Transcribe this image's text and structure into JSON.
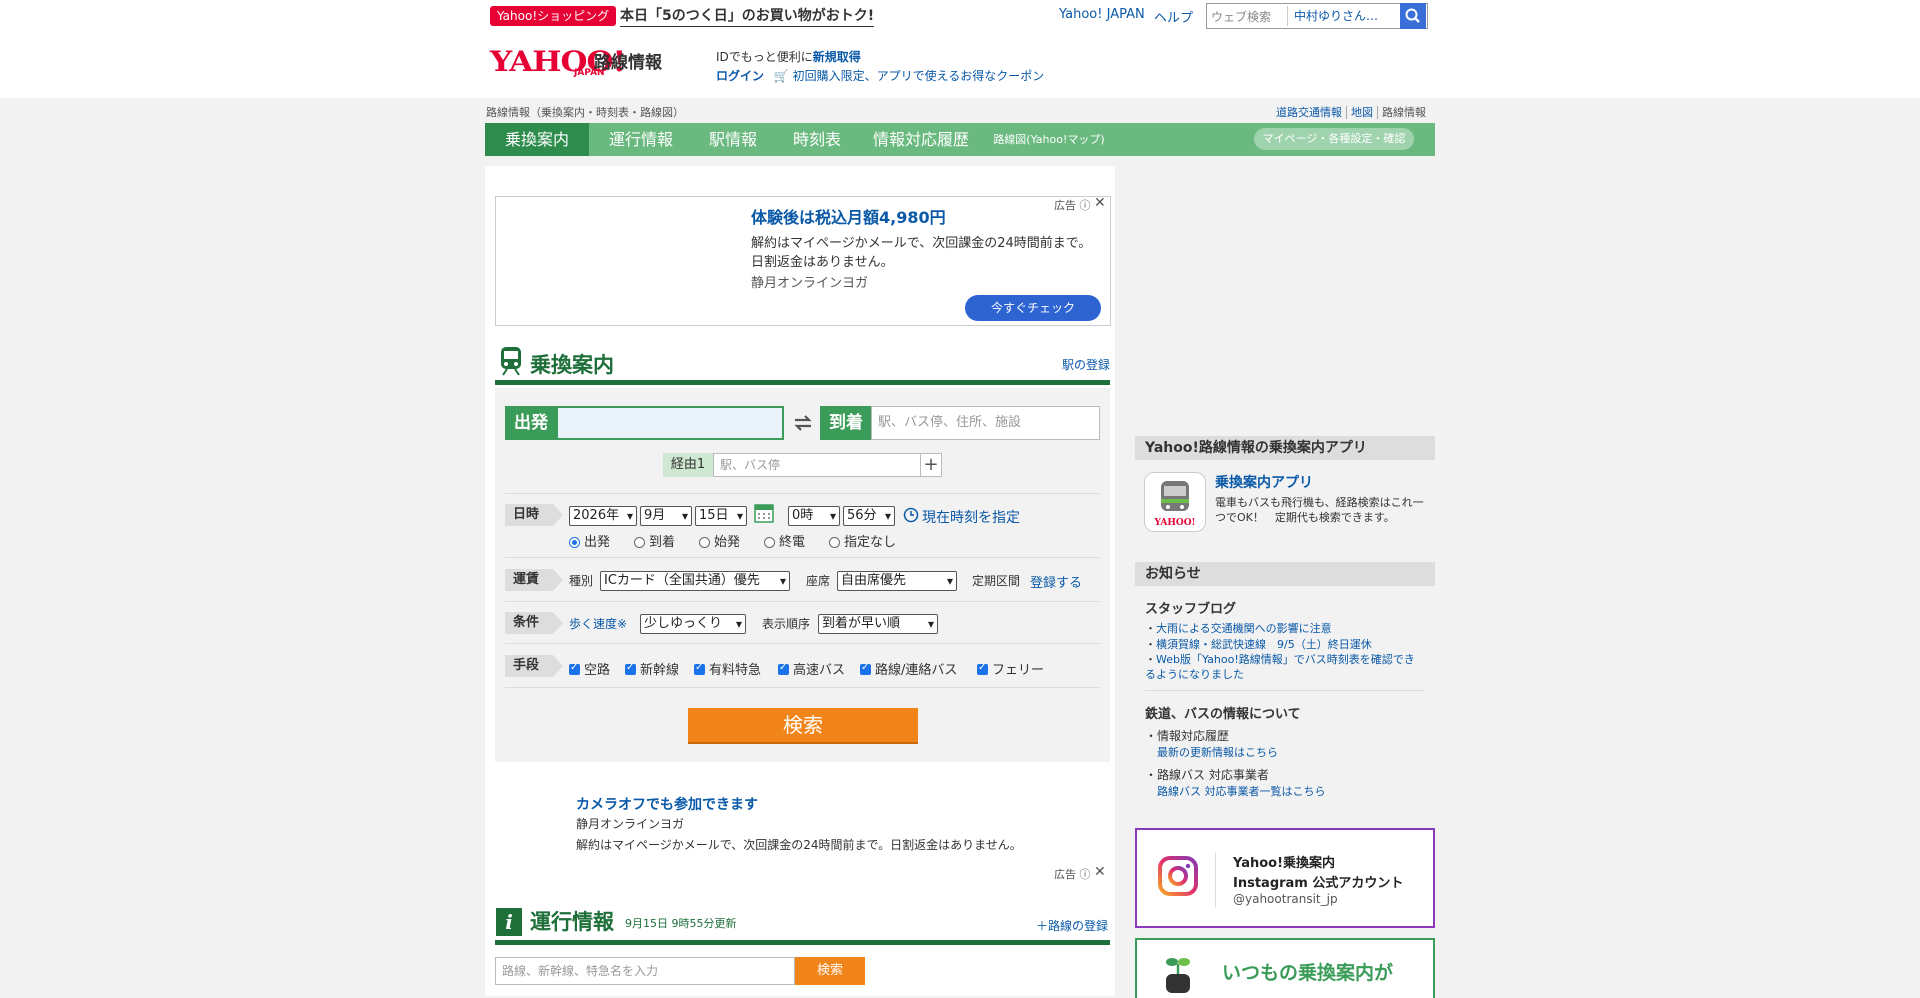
{
  "header": {
    "promo_tag": "Yahoo!ショッピング",
    "promo_text": "本日「5のつく日」のお買い物がおトク!",
    "link_japan": "Yahoo! JAPAN",
    "link_help": "ヘルプ",
    "search_placeholder": "ウェブ検索",
    "search_query": "中村ゆりさん…",
    "logo_text": "YAHOO!",
    "logo_sub": "JAPAN",
    "site_title": "路線情報",
    "id_line1_prefix": "IDでもっと便利に",
    "id_line1_link": "新規取得",
    "login": "ログイン",
    "coupon": "初回購入限定、アプリで使えるお得なクーポン"
  },
  "subbar": {
    "breadcrumb": "路線情報（乗換案内・時刻表・路線図）",
    "links": [
      "道路交通情報",
      "地図",
      "路線情報"
    ]
  },
  "nav": {
    "items": [
      "乗換案内",
      "運行情報",
      "駅情報",
      "時刻表",
      "情報対応履歴",
      "路線図(Yahoo!マップ)"
    ],
    "mypage": "マイページ・各種設定・確認"
  },
  "ad1": {
    "headline": "体験後は税込月額4,980円",
    "line1": "解約はマイページかメールで、次回課金の24時間前まで。",
    "line2": "日割返金はありません。",
    "sponsor": "静月オンラインヨガ",
    "button": "今すぐチェック",
    "label": "広告"
  },
  "transfer": {
    "title": "乗換案内",
    "register_station": "駅の登録",
    "from_label": "出発",
    "to_label": "到着",
    "to_placeholder": "駅、バス停、住所、施設",
    "via_label": "経由1",
    "via_placeholder": "駅、バス停",
    "date_label": "日時",
    "year": "2026年",
    "month": "9月",
    "day": "15日",
    "hour": "0時",
    "minute": "56分",
    "now_link": "現在時刻を指定",
    "time_options": [
      "出発",
      "到着",
      "始発",
      "終電",
      "指定なし"
    ],
    "fare_label": "運賃",
    "fare_type_label": "種別",
    "fare_type": "ICカード（全国共通）優先",
    "seat_label": "座席",
    "seat": "自由席優先",
    "commuter_label": "定期区間",
    "commuter_link": "登録する",
    "cond_label": "条件",
    "walk_speed_label": "歩く速度※",
    "walk_speed": "少しゆっくり",
    "order_label": "表示順序",
    "order": "到着が早い順",
    "means_label": "手段",
    "means": [
      "空路",
      "新幹線",
      "有料特急",
      "高速バス",
      "路線/連絡バス",
      "フェリー"
    ],
    "search_button": "検索"
  },
  "ad2": {
    "headline": "カメラオフでも参加できます",
    "sponsor": "静月オンラインヨガ",
    "text": "解約はマイページかメールで、次回課金の24時間前まで。日割返金はありません。",
    "label": "広告"
  },
  "operation": {
    "title": "運行情報",
    "updated": "9月15日 9時55分更新",
    "register_line": "＋路線の登録",
    "search_placeholder": "路線、新幹線、特急名を入力",
    "search_button": "検索"
  },
  "sidebar": {
    "app_header": "Yahoo!路線情報の乗換案内アプリ",
    "app_name": "乗換案内アプリ",
    "app_desc": "電車もバスも飛行機も、経路検索はこれ一つでOK！　定期代も検索できます。",
    "app_icon_label": "YAHOO!",
    "news_header": "お知らせ",
    "blog_title": "スタッフブログ",
    "blog_items": [
      "大雨による交通機関への影響に注意",
      "横須賀線・総武快速線　9/5（土）終日運休",
      "Web版「Yahoo!路線情報」でバス時刻表を確認できるようになりました"
    ],
    "info_title": "鉄道、バスの情報について",
    "info_item1": "情報対応履歴",
    "info_link1": "最新の更新情報はこちら",
    "info_item2": "路線バス 対応事業者",
    "info_link2": "路線バス 対応事業者一覧はこちら",
    "insta_line1": "Yahoo!乗換案内",
    "insta_line2": "Instagram 公式アカウント",
    "insta_handle": "@yahootransit_jp",
    "green_text": "いつもの乗換案内が"
  }
}
